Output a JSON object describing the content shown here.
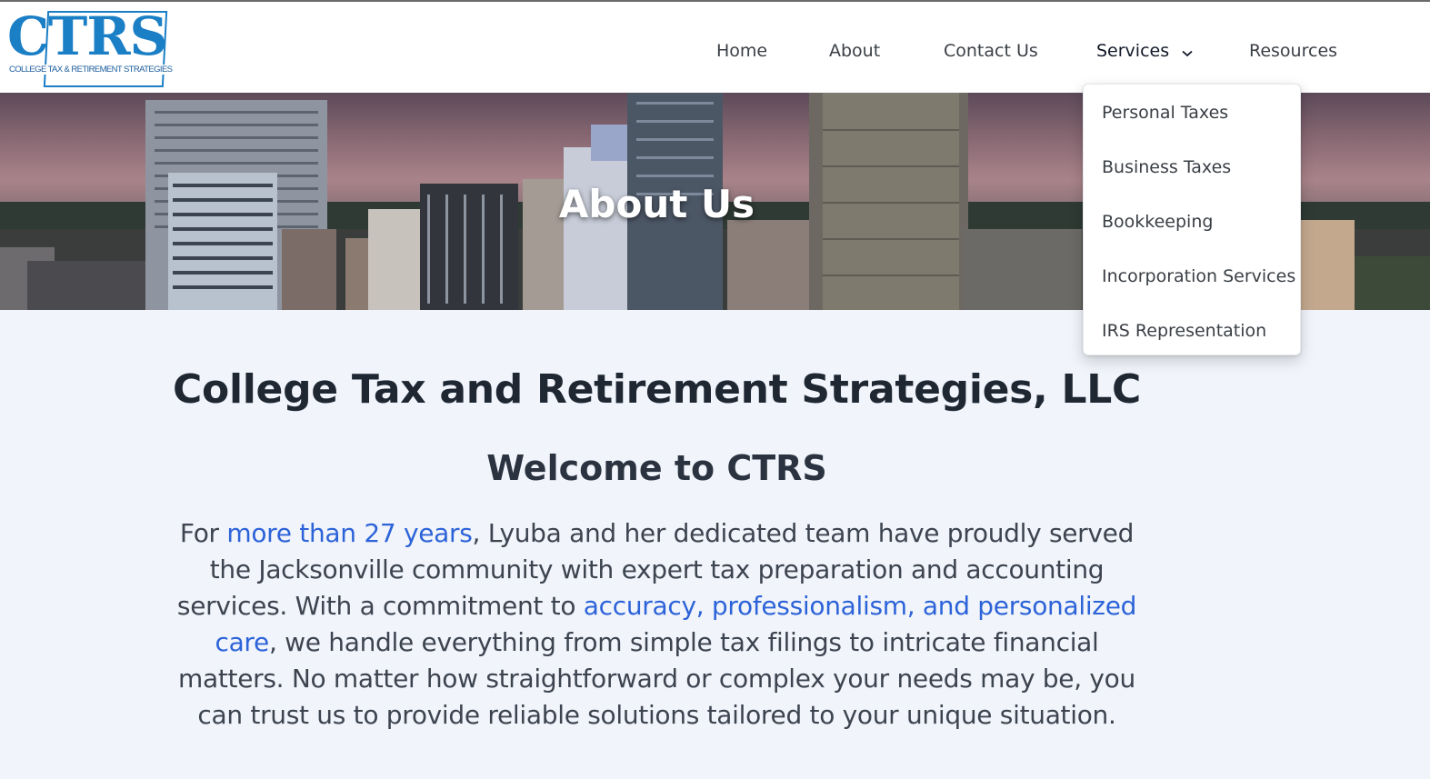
{
  "logo": {
    "main": "CTRS",
    "sub": "COLLEGE TAX & RETIREMENT STRATEGIES"
  },
  "nav": {
    "home": "Home",
    "about": "About",
    "contact": "Contact Us",
    "services": "Services",
    "resources": "Resources"
  },
  "services_menu": [
    "Personal Taxes",
    "Business Taxes",
    "Bookkeeping",
    "Incorporation Services",
    "IRS Representation"
  ],
  "hero": {
    "title": "About Us"
  },
  "content": {
    "company_name": "College Tax and Retirement Strategies, LLC",
    "welcome": "Welcome to CTRS",
    "paragraph": {
      "p1": "For ",
      "h1": "more than 27 years",
      "p2": ", Lyuba and her dedicated team have proudly served the Jacksonville community with expert tax preparation and accounting services. With a commitment to ",
      "h2": "accuracy, professionalism, and personalized care",
      "p3": ", we handle everything from simple tax filings to intricate financial matters. No matter how straightforward or complex your needs may be, you can trust us to provide reliable solutions tailored to your unique situation."
    }
  },
  "colors": {
    "brand_blue": "#1b7fc6",
    "link_blue": "#2d63d8",
    "page_bg": "#f1f5fb"
  }
}
